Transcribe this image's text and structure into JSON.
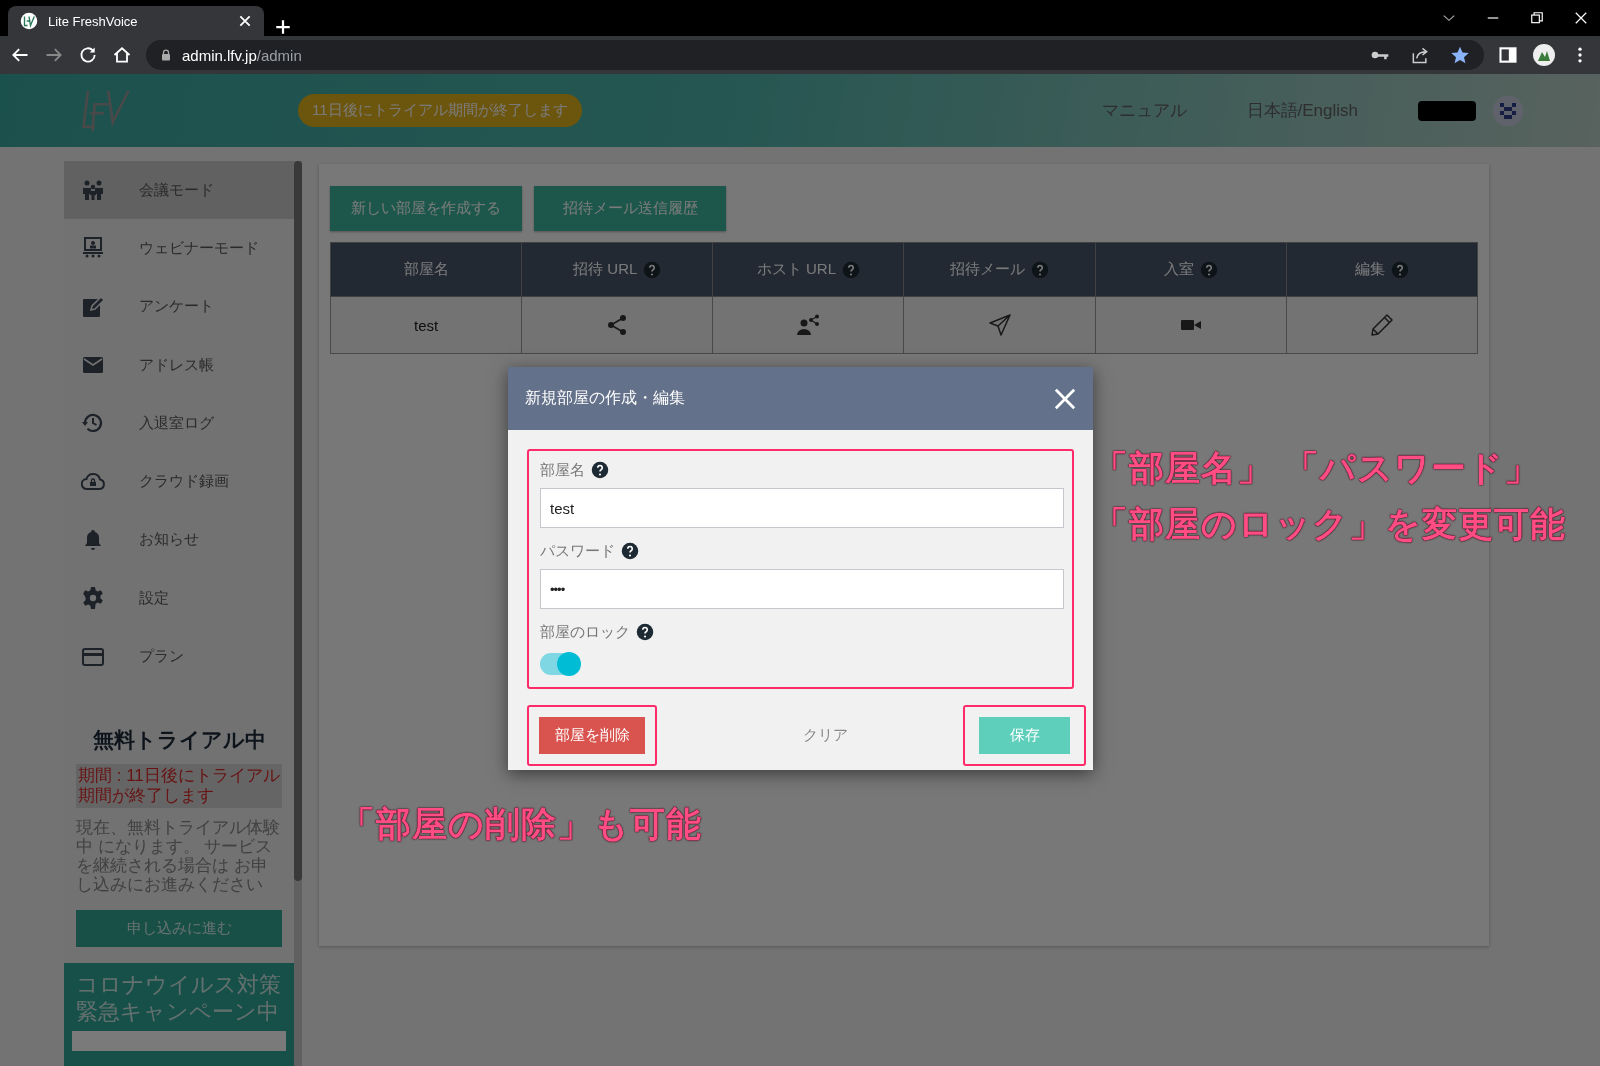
{
  "browser": {
    "tab_title": "Lite FreshVoice",
    "url_host": "admin.lfv.jp",
    "url_path": "/admin"
  },
  "header": {
    "trial_notice": "11日後にトライアル期間が終了します",
    "links": [
      "マニュアル",
      "日本語/English"
    ]
  },
  "sidebar": {
    "items": [
      {
        "label": "会議モード",
        "selected": true
      },
      {
        "label": "ウェビナーモード",
        "selected": false
      },
      {
        "label": "アンケート",
        "selected": false
      },
      {
        "label": "アドレス帳",
        "selected": false
      },
      {
        "label": "入退室ログ",
        "selected": false
      },
      {
        "label": "クラウド録画",
        "selected": false
      },
      {
        "label": "お知らせ",
        "selected": false
      },
      {
        "label": "設定",
        "selected": false
      },
      {
        "label": "プラン",
        "selected": false
      }
    ],
    "trial": {
      "title": "無料トライアル中",
      "period": "期間 : 11日後にトライアル期間が終了します",
      "description": "現在、無料トライアル体験中 になります。 サービスを継続される場合は お申し込みにお進みください",
      "button": "申し込みに進む"
    },
    "campaign": {
      "title": "コロナウイルス対策緊急キャンペーン中"
    }
  },
  "main": {
    "buttons": [
      "新しい部屋を作成する",
      "招待メール送信履歴"
    ],
    "table": {
      "columns": [
        {
          "label": "部屋名",
          "help": false
        },
        {
          "label": "招待 URL",
          "help": true
        },
        {
          "label": "ホスト URL",
          "help": true
        },
        {
          "label": "招待メール",
          "help": true
        },
        {
          "label": "入室",
          "help": true
        },
        {
          "label": "編集",
          "help": true
        }
      ],
      "rows": [
        {
          "cells": [
            {
              "kind": "text",
              "text": "test"
            },
            {
              "kind": "icon"
            },
            {
              "kind": "icon"
            },
            {
              "kind": "icon"
            },
            {
              "kind": "icon"
            },
            {
              "kind": "icon"
            }
          ]
        }
      ]
    }
  },
  "modal": {
    "title": "新規部屋の作成・編集",
    "fields": [
      {
        "label": "部屋名",
        "kind": "text",
        "value": "test"
      },
      {
        "label": "パスワード",
        "kind": "password",
        "value": "••••"
      }
    ],
    "lock": {
      "label": "部屋のロック",
      "on": true
    },
    "delete_button": "部屋を削除",
    "clear_button": "クリア",
    "save_button": "保存"
  },
  "annotations": [
    {
      "lines": [
        "「部屋名」 「パスワード」",
        "「部屋のロック」を変更可能"
      ]
    },
    {
      "lines": [
        "「部屋の削除」も可能"
      ]
    }
  ]
}
